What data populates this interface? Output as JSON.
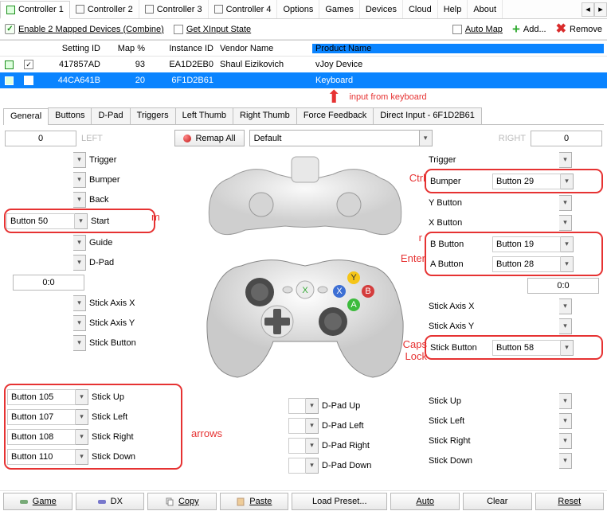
{
  "toptabs": [
    "Controller 1",
    "Controller 2",
    "Controller 3",
    "Controller 4",
    "Options",
    "Games",
    "Devices",
    "Cloud",
    "Help",
    "About"
  ],
  "toolbar": {
    "enable": "Enable 2 Mapped Devices (Combine)",
    "getx": "Get XInput State",
    "automap": "Auto Map",
    "add": "Add...",
    "remove": "Remove"
  },
  "grid": {
    "headers": [
      "",
      "",
      "Setting ID",
      "Map %",
      "Instance ID",
      "Vendor Name",
      "Product Name"
    ],
    "rows": [
      {
        "sq": "green",
        "chk": true,
        "setting": "417857AD",
        "map": "93",
        "inst": "EA1D2EB0",
        "vendor": "Shaul Eizikovich",
        "product": "vJoy Device",
        "sel": false
      },
      {
        "sq": "green",
        "chk": true,
        "setting": "44CA641B",
        "map": "20",
        "inst": "6F1D2B61",
        "vendor": "",
        "product": "Keyboard",
        "sel": true
      }
    ]
  },
  "annot1": "input from keyboard",
  "subtabs": [
    "General",
    "Buttons",
    "D-Pad",
    "Triggers",
    "Left Thumb",
    "Right Thumb",
    "Force Feedback",
    "Direct Input - 6F1D2B61"
  ],
  "top": {
    "leftnum": "0",
    "left": "LEFT",
    "remap": "Remap All",
    "preset": "Default",
    "right": "RIGHT",
    "rightnum": "0"
  },
  "left_rows": [
    {
      "val": "",
      "lbl": "Trigger"
    },
    {
      "val": "",
      "lbl": "Bumper"
    },
    {
      "val": "",
      "lbl": "Back"
    },
    {
      "val": "Button 50",
      "lbl": "Start",
      "ring": true
    },
    {
      "val": "",
      "lbl": "Guide"
    },
    {
      "val": "",
      "lbl": "D-Pad"
    }
  ],
  "left_ratio": "0:0",
  "left_axis": [
    {
      "val": "",
      "lbl": "Stick Axis X"
    },
    {
      "val": "",
      "lbl": "Stick Axis Y"
    },
    {
      "val": "",
      "lbl": "Stick Button"
    }
  ],
  "left_stick": [
    {
      "val": "Button 105",
      "lbl": "Stick Up"
    },
    {
      "val": "Button 107",
      "lbl": "Stick Left"
    },
    {
      "val": "Button 108",
      "lbl": "Stick Right"
    },
    {
      "val": "Button 110",
      "lbl": "Stick Down"
    }
  ],
  "right_rows": [
    {
      "lbl": "Trigger",
      "val": ""
    },
    {
      "lbl": "Bumper",
      "val": "Button 29",
      "ring": true
    },
    {
      "lbl": "Y Button",
      "val": ""
    },
    {
      "lbl": "X Button",
      "val": ""
    },
    {
      "lbl": "B Button",
      "val": "Button 19",
      "ringTop": true
    },
    {
      "lbl": "A Button",
      "val": "Button 28",
      "ringBot": true
    }
  ],
  "right_ratio": "0:0",
  "right_axis": [
    {
      "lbl": "Stick Axis X",
      "val": ""
    },
    {
      "lbl": "Stick Axis Y",
      "val": ""
    },
    {
      "lbl": "Stick Button",
      "val": "Button 58",
      "ring": true
    }
  ],
  "right_stick": [
    {
      "lbl": "Stick Up",
      "val": ""
    },
    {
      "lbl": "Stick Left",
      "val": ""
    },
    {
      "lbl": "Stick Right",
      "val": ""
    },
    {
      "lbl": "Stick Down",
      "val": ""
    }
  ],
  "dpad": [
    "D-Pad Up",
    "D-Pad Left",
    "D-Pad Right",
    "D-Pad Down"
  ],
  "red": {
    "m": "m",
    "ctrl": "Ctrl",
    "r": "r",
    "enter": "Enter",
    "caps": "Caps\nLock",
    "arrows": "arrows"
  },
  "bbar": [
    "Game",
    "DX",
    "Copy",
    "Paste",
    "Load Preset...",
    "Auto",
    "Clear",
    "Reset"
  ]
}
